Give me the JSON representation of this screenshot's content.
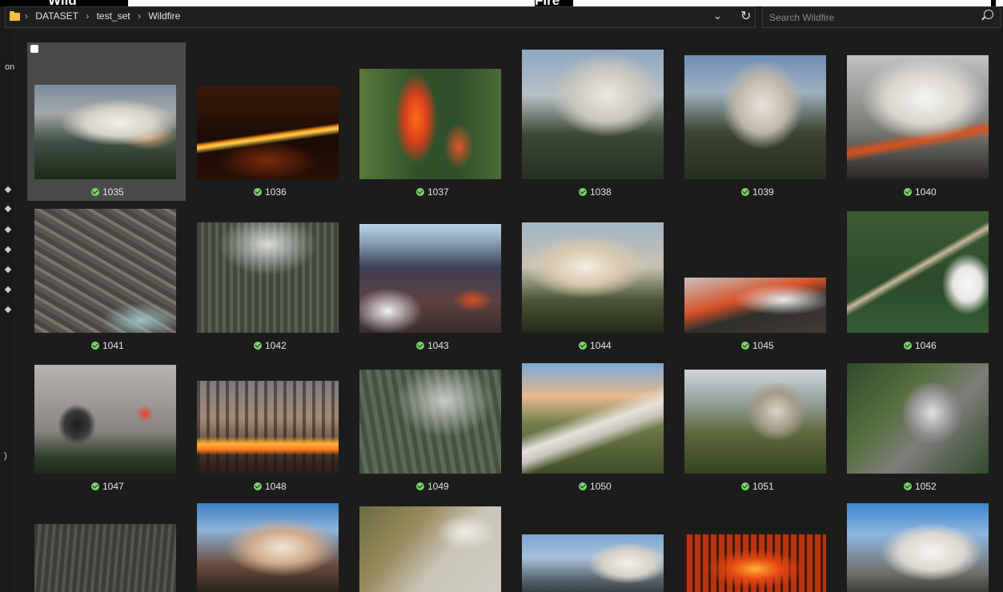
{
  "window": {
    "title_left": "Wild",
    "title_right": "Fire"
  },
  "address_bar": {
    "crumbs": [
      "DATASET",
      "test_set",
      "Wildfire"
    ]
  },
  "search": {
    "placeholder": "Search Wildfire"
  },
  "nav": {
    "fragment_top": "on",
    "fragment_bottom": ")"
  },
  "files": [
    {
      "label": "1035",
      "status": "synced",
      "selected": true
    },
    {
      "label": "1036",
      "status": "synced"
    },
    {
      "label": "1037",
      "status": "synced"
    },
    {
      "label": "1038",
      "status": "synced"
    },
    {
      "label": "1039",
      "status": "synced"
    },
    {
      "label": "1040",
      "status": "synced"
    },
    {
      "label": "1041",
      "status": "synced"
    },
    {
      "label": "1042",
      "status": "synced"
    },
    {
      "label": "1043",
      "status": "synced"
    },
    {
      "label": "1044",
      "status": "synced"
    },
    {
      "label": "1045",
      "status": "synced"
    },
    {
      "label": "1046",
      "status": "synced"
    },
    {
      "label": "1047",
      "status": "synced"
    },
    {
      "label": "1048",
      "status": "synced"
    },
    {
      "label": "1049",
      "status": "synced"
    },
    {
      "label": "1050",
      "status": "synced"
    },
    {
      "label": "1051",
      "status": "synced"
    },
    {
      "label": "1052",
      "status": "synced"
    }
  ],
  "colors": {
    "background": "#1c1c1c",
    "folder": "#f2c23c",
    "check": "#7bd36b"
  }
}
